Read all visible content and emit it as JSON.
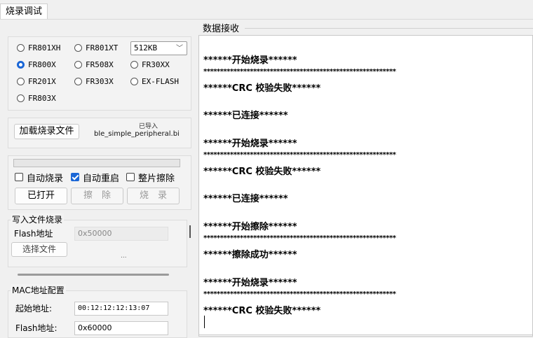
{
  "tab": {
    "label": "烧录调试"
  },
  "chip": {
    "radios": [
      {
        "label": "FR801XH",
        "checked": false
      },
      {
        "label": "FR801XT",
        "checked": false
      },
      {
        "label": "FR800X",
        "checked": true
      },
      {
        "label": "FR508X",
        "checked": false
      },
      {
        "label": "FR30XX",
        "checked": false
      },
      {
        "label": "FR201X",
        "checked": false
      },
      {
        "label": "FR303X",
        "checked": false
      },
      {
        "label": "EX-FLASH",
        "checked": false
      },
      {
        "label": "FR803X",
        "checked": false
      }
    ],
    "size_select": {
      "value": "512KB"
    }
  },
  "file": {
    "load_button": "加载烧录文件",
    "status": "已导入",
    "filename": "ble_simple_peripheral.bi"
  },
  "burn": {
    "progress": 0,
    "auto_burn": {
      "label": "自动烧录",
      "checked": false
    },
    "auto_restart": {
      "label": "自动重启",
      "checked": true
    },
    "chip_erase": {
      "label": "整片擦除",
      "checked": false
    },
    "open_button": "已打开",
    "erase_button": "擦　除",
    "burn_button": "烧　录"
  },
  "write_file": {
    "title": "写入文件烧录",
    "flash_label": "Flash地址",
    "flash_value": "0x50000",
    "select_button": "选择文件",
    "ellipsis": "..."
  },
  "mac": {
    "title": "MAC地址配置",
    "start_label": "起始地址:",
    "start_value": "00:12:12:12:13:07",
    "flash_label": "Flash地址:",
    "flash_value": "0x60000"
  },
  "log": {
    "title": "数据接收",
    "lines": [
      "******开始烧录******",
      "**********************************************************",
      "******CRC 校验失败******",
      "******已连接******",
      "******开始烧录******",
      "**********************************************************",
      "******CRC 校验失败******",
      "******已连接******",
      "******开始擦除******",
      "**********************************************************",
      "******擦除成功******",
      "******开始烧录******",
      "**********************************************************",
      "******CRC 校验失败******"
    ]
  },
  "colors": {
    "accent": "#1a66d6"
  }
}
